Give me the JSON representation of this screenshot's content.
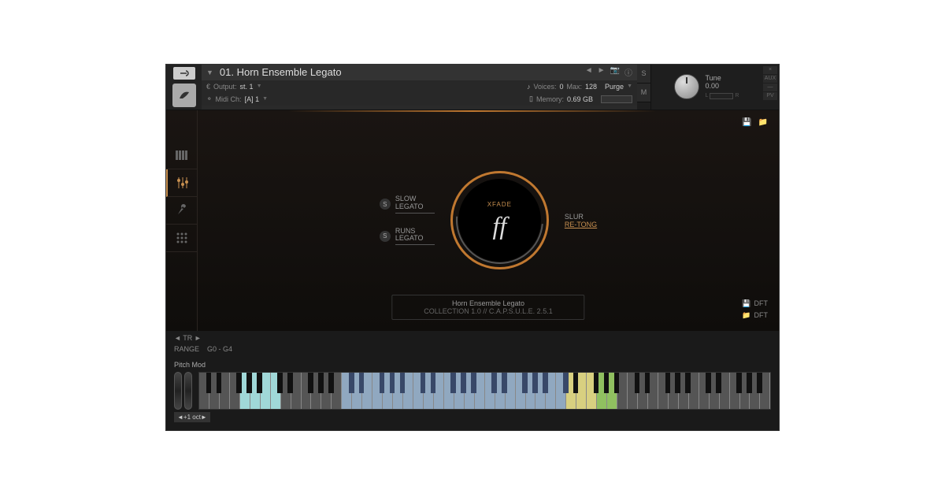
{
  "header": {
    "title": "01. Horn Ensemble Legato",
    "output_label": "Output:",
    "output_value": "st. 1",
    "midi_label": "Midi Ch:",
    "midi_value": "[A] 1",
    "voices_label": "Voices:",
    "voices_value": "0",
    "max_label": "Max:",
    "max_value": "128",
    "purge_label": "Purge",
    "memory_label": "Memory:",
    "memory_value": "0.69 GB",
    "tune_label": "Tune",
    "tune_value": "0.00",
    "s_btn": "S",
    "m_btn": "M",
    "aux": "AUX",
    "pv": "PV"
  },
  "main": {
    "slow_legato": "SLOW\nLEGATO",
    "runs_legato": "RUNS\nLEGATO",
    "xfade": "XFADE",
    "ff": "ff",
    "slur": "SLUR",
    "retong": "RE-TONG",
    "info_name": "Horn Ensemble Legato",
    "info_version": "COLLECTION 1.0  //  C.A.P.S.U.L.E. 2.5.1",
    "dft": "DFT"
  },
  "transport": {
    "tr": "TR",
    "range_label": "RANGE",
    "range_value": "G0 - G4"
  },
  "keyboard": {
    "pitch_mod": "Pitch Mod",
    "oct": "◄+1 oct►"
  }
}
